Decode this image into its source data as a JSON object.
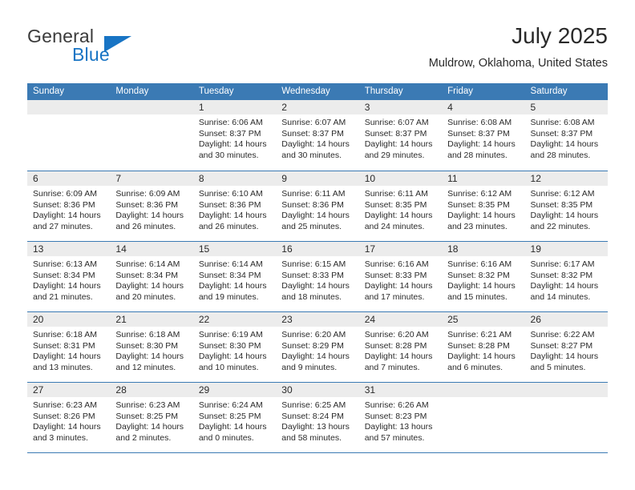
{
  "brand": {
    "word_one": "General",
    "word_two": "Blue",
    "logo_color": "#1874c4",
    "triangle_icon": "triangle-right-icon"
  },
  "header": {
    "month_title": "July 2025",
    "location": "Muldrow, Oklahoma, United States"
  },
  "theme": {
    "header_blue": "#3b7ab4",
    "date_band_gray": "#ececec",
    "text": "#2a2a2a"
  },
  "weekdays": [
    "Sunday",
    "Monday",
    "Tuesday",
    "Wednesday",
    "Thursday",
    "Friday",
    "Saturday"
  ],
  "weeks": [
    [
      {
        "day": "",
        "empty": true
      },
      {
        "day": "",
        "empty": true
      },
      {
        "day": "1",
        "sunrise": "Sunrise: 6:06 AM",
        "sunset": "Sunset: 8:37 PM",
        "daylight_1": "Daylight: 14 hours",
        "daylight_2": "and 30 minutes."
      },
      {
        "day": "2",
        "sunrise": "Sunrise: 6:07 AM",
        "sunset": "Sunset: 8:37 PM",
        "daylight_1": "Daylight: 14 hours",
        "daylight_2": "and 30 minutes."
      },
      {
        "day": "3",
        "sunrise": "Sunrise: 6:07 AM",
        "sunset": "Sunset: 8:37 PM",
        "daylight_1": "Daylight: 14 hours",
        "daylight_2": "and 29 minutes."
      },
      {
        "day": "4",
        "sunrise": "Sunrise: 6:08 AM",
        "sunset": "Sunset: 8:37 PM",
        "daylight_1": "Daylight: 14 hours",
        "daylight_2": "and 28 minutes."
      },
      {
        "day": "5",
        "sunrise": "Sunrise: 6:08 AM",
        "sunset": "Sunset: 8:37 PM",
        "daylight_1": "Daylight: 14 hours",
        "daylight_2": "and 28 minutes."
      }
    ],
    [
      {
        "day": "6",
        "sunrise": "Sunrise: 6:09 AM",
        "sunset": "Sunset: 8:36 PM",
        "daylight_1": "Daylight: 14 hours",
        "daylight_2": "and 27 minutes."
      },
      {
        "day": "7",
        "sunrise": "Sunrise: 6:09 AM",
        "sunset": "Sunset: 8:36 PM",
        "daylight_1": "Daylight: 14 hours",
        "daylight_2": "and 26 minutes."
      },
      {
        "day": "8",
        "sunrise": "Sunrise: 6:10 AM",
        "sunset": "Sunset: 8:36 PM",
        "daylight_1": "Daylight: 14 hours",
        "daylight_2": "and 26 minutes."
      },
      {
        "day": "9",
        "sunrise": "Sunrise: 6:11 AM",
        "sunset": "Sunset: 8:36 PM",
        "daylight_1": "Daylight: 14 hours",
        "daylight_2": "and 25 minutes."
      },
      {
        "day": "10",
        "sunrise": "Sunrise: 6:11 AM",
        "sunset": "Sunset: 8:35 PM",
        "daylight_1": "Daylight: 14 hours",
        "daylight_2": "and 24 minutes."
      },
      {
        "day": "11",
        "sunrise": "Sunrise: 6:12 AM",
        "sunset": "Sunset: 8:35 PM",
        "daylight_1": "Daylight: 14 hours",
        "daylight_2": "and 23 minutes."
      },
      {
        "day": "12",
        "sunrise": "Sunrise: 6:12 AM",
        "sunset": "Sunset: 8:35 PM",
        "daylight_1": "Daylight: 14 hours",
        "daylight_2": "and 22 minutes."
      }
    ],
    [
      {
        "day": "13",
        "sunrise": "Sunrise: 6:13 AM",
        "sunset": "Sunset: 8:34 PM",
        "daylight_1": "Daylight: 14 hours",
        "daylight_2": "and 21 minutes."
      },
      {
        "day": "14",
        "sunrise": "Sunrise: 6:14 AM",
        "sunset": "Sunset: 8:34 PM",
        "daylight_1": "Daylight: 14 hours",
        "daylight_2": "and 20 minutes."
      },
      {
        "day": "15",
        "sunrise": "Sunrise: 6:14 AM",
        "sunset": "Sunset: 8:34 PM",
        "daylight_1": "Daylight: 14 hours",
        "daylight_2": "and 19 minutes."
      },
      {
        "day": "16",
        "sunrise": "Sunrise: 6:15 AM",
        "sunset": "Sunset: 8:33 PM",
        "daylight_1": "Daylight: 14 hours",
        "daylight_2": "and 18 minutes."
      },
      {
        "day": "17",
        "sunrise": "Sunrise: 6:16 AM",
        "sunset": "Sunset: 8:33 PM",
        "daylight_1": "Daylight: 14 hours",
        "daylight_2": "and 17 minutes."
      },
      {
        "day": "18",
        "sunrise": "Sunrise: 6:16 AM",
        "sunset": "Sunset: 8:32 PM",
        "daylight_1": "Daylight: 14 hours",
        "daylight_2": "and 15 minutes."
      },
      {
        "day": "19",
        "sunrise": "Sunrise: 6:17 AM",
        "sunset": "Sunset: 8:32 PM",
        "daylight_1": "Daylight: 14 hours",
        "daylight_2": "and 14 minutes."
      }
    ],
    [
      {
        "day": "20",
        "sunrise": "Sunrise: 6:18 AM",
        "sunset": "Sunset: 8:31 PM",
        "daylight_1": "Daylight: 14 hours",
        "daylight_2": "and 13 minutes."
      },
      {
        "day": "21",
        "sunrise": "Sunrise: 6:18 AM",
        "sunset": "Sunset: 8:30 PM",
        "daylight_1": "Daylight: 14 hours",
        "daylight_2": "and 12 minutes."
      },
      {
        "day": "22",
        "sunrise": "Sunrise: 6:19 AM",
        "sunset": "Sunset: 8:30 PM",
        "daylight_1": "Daylight: 14 hours",
        "daylight_2": "and 10 minutes."
      },
      {
        "day": "23",
        "sunrise": "Sunrise: 6:20 AM",
        "sunset": "Sunset: 8:29 PM",
        "daylight_1": "Daylight: 14 hours",
        "daylight_2": "and 9 minutes."
      },
      {
        "day": "24",
        "sunrise": "Sunrise: 6:20 AM",
        "sunset": "Sunset: 8:28 PM",
        "daylight_1": "Daylight: 14 hours",
        "daylight_2": "and 7 minutes."
      },
      {
        "day": "25",
        "sunrise": "Sunrise: 6:21 AM",
        "sunset": "Sunset: 8:28 PM",
        "daylight_1": "Daylight: 14 hours",
        "daylight_2": "and 6 minutes."
      },
      {
        "day": "26",
        "sunrise": "Sunrise: 6:22 AM",
        "sunset": "Sunset: 8:27 PM",
        "daylight_1": "Daylight: 14 hours",
        "daylight_2": "and 5 minutes."
      }
    ],
    [
      {
        "day": "27",
        "sunrise": "Sunrise: 6:23 AM",
        "sunset": "Sunset: 8:26 PM",
        "daylight_1": "Daylight: 14 hours",
        "daylight_2": "and 3 minutes."
      },
      {
        "day": "28",
        "sunrise": "Sunrise: 6:23 AM",
        "sunset": "Sunset: 8:25 PM",
        "daylight_1": "Daylight: 14 hours",
        "daylight_2": "and 2 minutes."
      },
      {
        "day": "29",
        "sunrise": "Sunrise: 6:24 AM",
        "sunset": "Sunset: 8:25 PM",
        "daylight_1": "Daylight: 14 hours",
        "daylight_2": "and 0 minutes."
      },
      {
        "day": "30",
        "sunrise": "Sunrise: 6:25 AM",
        "sunset": "Sunset: 8:24 PM",
        "daylight_1": "Daylight: 13 hours",
        "daylight_2": "and 58 minutes."
      },
      {
        "day": "31",
        "sunrise": "Sunrise: 6:26 AM",
        "sunset": "Sunset: 8:23 PM",
        "daylight_1": "Daylight: 13 hours",
        "daylight_2": "and 57 minutes."
      },
      {
        "day": "",
        "empty": true
      },
      {
        "day": "",
        "empty": true
      }
    ]
  ]
}
